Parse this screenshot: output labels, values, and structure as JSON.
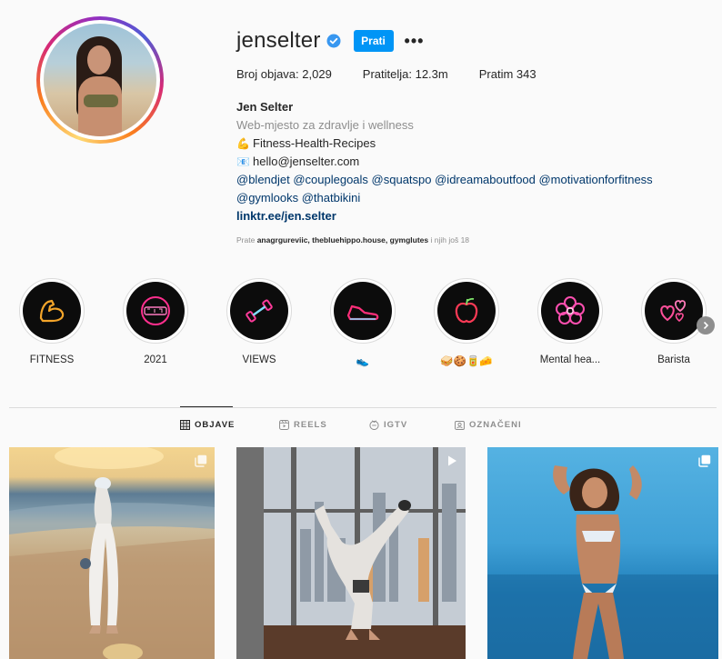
{
  "profile": {
    "username": "jenselter",
    "verified": true,
    "follow_label": "Prati",
    "more_label": "•••",
    "stats": {
      "posts": "Broj objava: 2,029",
      "followers": "Pratitelja: 12.3m",
      "following": "Pratim 343"
    },
    "bio": {
      "name": "Jen Selter",
      "category": "Web-mjesto za zdravlje i wellness",
      "line1_emoji": "💪",
      "line1": "Fitness-Health-Recipes",
      "line2_emoji": "📧",
      "line2": "hello@jenselter.com",
      "tags_line1": "@blendjet @couplegoals @squatspo @idreamaboutfood @motivationforfitness",
      "tags_line2": "@gymlooks @thatbikini",
      "link": "linktr.ee/jen.selter"
    },
    "followed_by": {
      "prefix": "Prate ",
      "names": "anagrgureviic, thebluehippo.house, gymglutes",
      "suffix": " i njih još 18"
    }
  },
  "highlights": [
    {
      "label": "FITNESS",
      "icon": "flexed-arm-neon-icon"
    },
    {
      "label": "2021",
      "icon": "neon-2021-badge-icon"
    },
    {
      "label": "VIEWS",
      "icon": "dumbbell-neon-icon"
    },
    {
      "label": "👟",
      "icon": "sneaker-neon-icon"
    },
    {
      "label": "🥪🍪🥫🧀",
      "icon": "apple-neon-icon"
    },
    {
      "label": "Mental hea...",
      "icon": "flower-neon-icon"
    },
    {
      "label": "Barista",
      "icon": "hearts-neon-icon"
    }
  ],
  "tabs": [
    {
      "label": "OBJAVE",
      "icon": "grid-icon",
      "active": true
    },
    {
      "label": "REELS",
      "icon": "reels-icon",
      "active": false
    },
    {
      "label": "IGTV",
      "icon": "igtv-icon",
      "active": false
    },
    {
      "label": "OZNAČENI",
      "icon": "tagged-icon",
      "active": false
    }
  ],
  "posts": [
    {
      "kind": "beach-sunset-photo",
      "badge": "multi-photo-icon"
    },
    {
      "kind": "handstand-city-window-photo",
      "badge": "video-icon"
    },
    {
      "kind": "bikini-ocean-photo",
      "badge": "multi-photo-icon"
    }
  ],
  "colors": {
    "follow_button": "#0095f6",
    "link": "#00376b",
    "muted": "#8e8e8e"
  }
}
